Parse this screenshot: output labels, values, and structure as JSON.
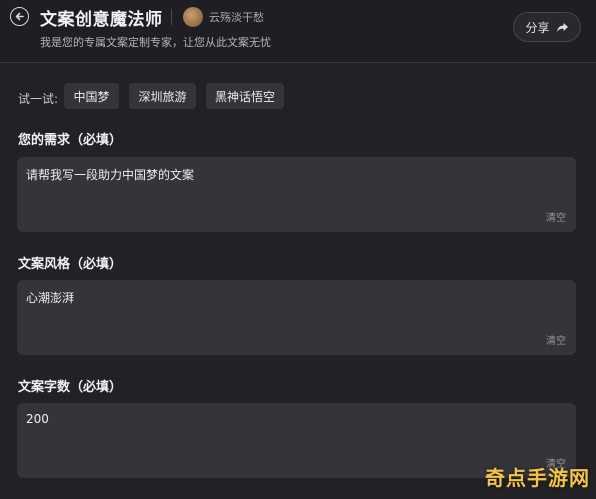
{
  "header": {
    "title": "文案创意魔法师",
    "author": "云殇淡干愁",
    "subtitle": "我是您的专属文案定制专家，让您从此文案无忧",
    "share_label": "分享"
  },
  "suggestions": {
    "label": "试一试:",
    "chips": [
      "中国梦",
      "深圳旅游",
      "黑神话悟空"
    ]
  },
  "fields": [
    {
      "label": "您的需求（必填）",
      "value": "请帮我写一段助力中国梦的文案",
      "clear_label": "清空"
    },
    {
      "label": "文案风格（必填）",
      "value": "心潮澎湃",
      "clear_label": "清空"
    },
    {
      "label": "文案字数（必填）",
      "value": "200",
      "clear_label": "清空"
    }
  ],
  "watermark": "奇点手游网",
  "colors": {
    "background": "#222226",
    "field": "#34343a",
    "watermark": "#f3c44a"
  },
  "icons": [
    "back-arrow-icon",
    "share-icon",
    "avatar"
  ]
}
